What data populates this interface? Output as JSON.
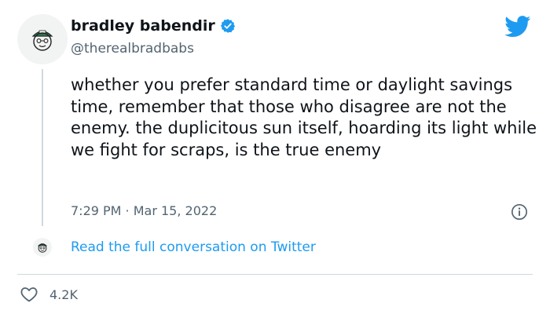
{
  "author": {
    "name": "bradley babendir",
    "handle": "@therealbradbabs",
    "avatar_icon": "cartoon-face-with-cap-icon",
    "verified_icon": "verified-badge-icon"
  },
  "tweet": {
    "text": "whether you prefer standard time or daylight savings time, remember that those who disagree are not the enemy. the duplicitous sun itself, hoarding its light while we fight for scraps, is the true enemy",
    "timestamp": "7:29 PM · Mar 15, 2022"
  },
  "conversation": {
    "link_label": "Read the full conversation on Twitter"
  },
  "engagement": {
    "likes": "4.2K",
    "like_icon": "heart-outline-icon"
  },
  "icons": {
    "brand": "twitter-bird-icon",
    "info": "info-icon"
  },
  "colors": {
    "accent": "#1d9bf0",
    "text": "#0f1419",
    "muted": "#536471",
    "divider": "#cfd9de"
  }
}
